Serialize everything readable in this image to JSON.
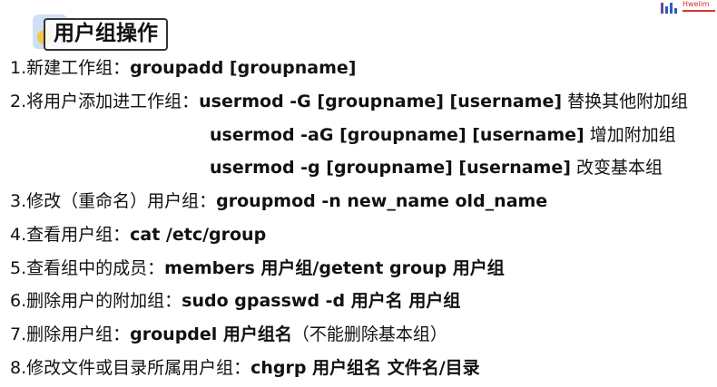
{
  "slide": {
    "title": "用户组操作",
    "logo": {
      "text": "Hwelim",
      "colors": {
        "bar1": "#7a3fa0",
        "bar2": "#2d5bbf",
        "bar3": "#2d5bbf",
        "accent": "#dd3333"
      }
    }
  },
  "lines": [
    {
      "label": "1.新建工作组：",
      "cmd": "groupadd  [groupname]",
      "note": ""
    },
    {
      "label": "2.将用户添加进工作组：",
      "cmd": "usermod -G [groupname] [username]",
      "note": "   替换其他附加组"
    },
    {
      "label": "",
      "cmd": "usermod -aG [groupname] [username]",
      "note": "   增加附加组"
    },
    {
      "label": "",
      "cmd": "usermod -g [groupname] [username]",
      "note": "  改变基本组"
    },
    {
      "label": "3.修改（重命名）用户组：",
      "cmd": "groupmod -n new_name  old_name",
      "note": ""
    },
    {
      "label": "4.查看用户组：",
      "cmd": "cat /etc/group",
      "note": ""
    },
    {
      "label": "5.查看组中的成员：",
      "cmd": "members  用户组/getent group 用户组",
      "note": ""
    },
    {
      "label": "6.删除用户的附加组：",
      "cmd": "sudo  gpasswd -d 用户名 用户组",
      "note": ""
    },
    {
      "label": "7.删除用户组：",
      "cmd": "groupdel 用户组名",
      "note": "（不能删除基本组）"
    },
    {
      "label": "8.修改文件或目录所属用户组：",
      "cmd": "chgrp  用户组名  文件名/目录",
      "note": ""
    }
  ]
}
